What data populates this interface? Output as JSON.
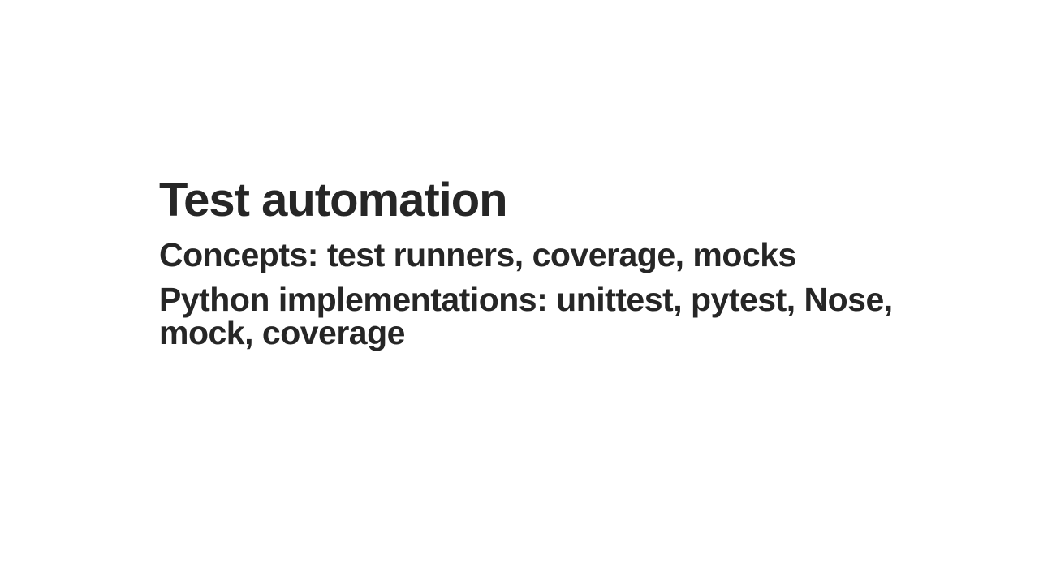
{
  "slide": {
    "title": "Test automation",
    "subtitle1": "Concepts: test runners, coverage, mocks",
    "subtitle2": "Python implementations: unittest, pytest, Nose, mock, coverage"
  }
}
